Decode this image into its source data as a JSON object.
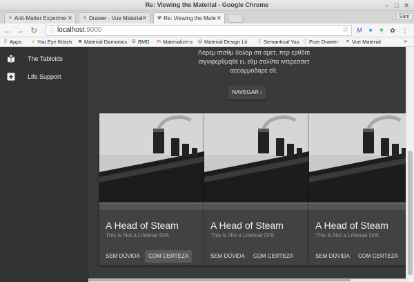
{
  "window": {
    "title": "Re: Viewing the Material - Google Chrome",
    "profile": "Sam"
  },
  "tabs": [
    {
      "label": "Anti-Matter Experime",
      "icon": "vue-logo-icon"
    },
    {
      "label": "Drawer - Vue Material",
      "icon": "vue-logo-icon"
    },
    {
      "label": "Re: Viewing the Mate",
      "icon": "radiation-icon",
      "active": true
    }
  ],
  "toolbar": {
    "url_host": "localhost",
    "url_port": ":9000"
  },
  "bookmarks": [
    {
      "label": "Apps",
      "icon": "apps-grid-icon"
    },
    {
      "label": "You Eye Kitsch",
      "icon": "kitsch-icon"
    },
    {
      "label": "Material Damonics",
      "icon": "material-icon"
    },
    {
      "label": "BMD",
      "icon": "bootstrap-icon"
    },
    {
      "label": "Materialize-o",
      "icon": "materialize-icon"
    },
    {
      "label": "Material Design Lit",
      "icon": "mdl-icon"
    },
    {
      "label": "Semantical You",
      "icon": "page-icon"
    },
    {
      "label": "Pure Drawer",
      "icon": "page-icon"
    },
    {
      "label": "Vue Material",
      "icon": "vue-logo-icon"
    }
  ],
  "sidebar": {
    "items": [
      {
        "label": "The Tabloids",
        "icon": "book-icon"
      },
      {
        "label": "Life Support",
        "icon": "plus-box-icon"
      }
    ]
  },
  "hero": {
    "text_line1": "Λορεμ ιπσθμ δολορ σιτ αμετ, περ ερθδιτι",
    "text_line2": "σιγνιφερθμqθε ει, εθμ σαλθτα ιντερεσσετ",
    "text_line3": "αccομμοδαρε cθ.",
    "button_label": "NAVEGAR"
  },
  "cards": [
    {
      "title": "A Head of Steam",
      "subtitle": "This Is Not a Lifeboat Drill.",
      "action1": "SEM DÚVIDA",
      "action2": "COM CERTEZA"
    },
    {
      "title": "A Head of Steam",
      "subtitle": "This Is Not a Lifeboat Drill.",
      "action1": "SEM DÚVIDA",
      "action2": "COM CERTEZA"
    },
    {
      "title": "A Head of Steam",
      "subtitle": "This Is Not a Lifeboat Drill.",
      "action1": "SEM DÚVIDA",
      "action2": "COM CERTEZA"
    }
  ],
  "colors": {
    "page_bg": "#3a3a3a",
    "sidebar_bg": "#333333",
    "card_bg": "#424242"
  }
}
